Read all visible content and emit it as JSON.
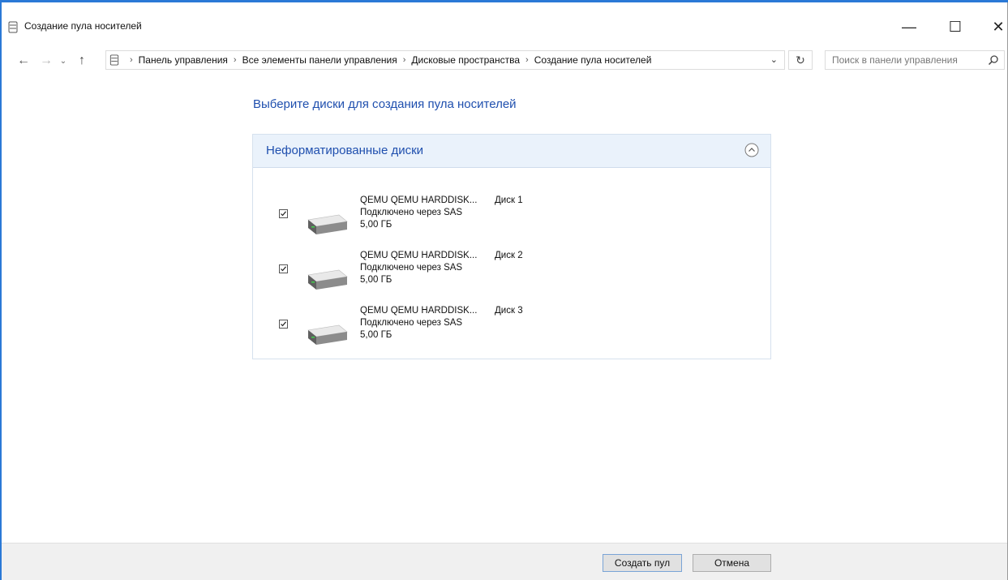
{
  "window": {
    "title": "Создание пула носителей",
    "minimize_glyph": "—",
    "maximize_glyph": "☐",
    "close_glyph": "✕"
  },
  "nav": {
    "breadcrumbs": [
      "Панель управления",
      "Все элементы панели управления",
      "Дисковые пространства",
      "Создание пула носителей"
    ],
    "search_placeholder": "Поиск в панели управления"
  },
  "main": {
    "heading": "Выберите диски для создания пула носителей",
    "group_title": "Неформатированные диски",
    "disks": [
      {
        "name": "QEMU QEMU HARDDISK...",
        "number": "Диск 1",
        "connection": "Подключено через SAS",
        "size": "5,00 ГБ",
        "checked": true
      },
      {
        "name": "QEMU QEMU HARDDISK...",
        "number": "Диск 2",
        "connection": "Подключено через SAS",
        "size": "5,00 ГБ",
        "checked": true
      },
      {
        "name": "QEMU QEMU HARDDISK...",
        "number": "Диск 3",
        "connection": "Подключено через SAS",
        "size": "5,00 ГБ",
        "checked": true
      }
    ]
  },
  "footer": {
    "create_label": "Создать пул",
    "cancel_label": "Отмена"
  },
  "colors": {
    "accent": "#2b79d6",
    "heading": "#1f4fae",
    "group_header_bg": "#eaf2fb"
  }
}
